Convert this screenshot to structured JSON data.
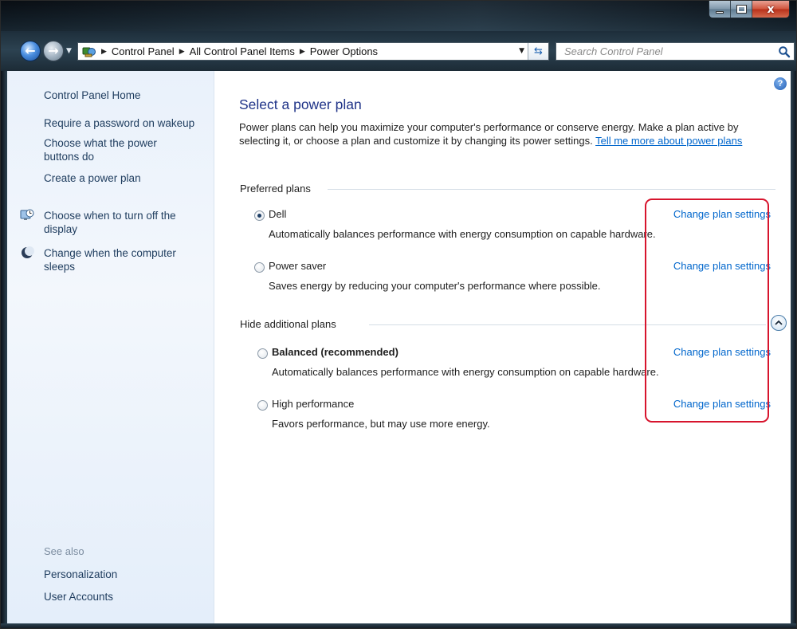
{
  "window": {
    "minimize_icon": "minimize-icon",
    "maximize_icon": "maximize-icon",
    "close_icon": "close-icon",
    "close_glyph": "x"
  },
  "nav": {
    "back_glyph": "←",
    "forward_glyph": "→",
    "breadcrumb": [
      "Control Panel",
      "All Control Panel Items",
      "Power Options"
    ],
    "refresh_glyph": "⇆",
    "search_placeholder": "Search Control Panel"
  },
  "sidebar": {
    "home": "Control Panel Home",
    "links": [
      "Require a password on wakeup",
      "Choose what the power buttons do",
      "Create a power plan",
      "Choose when to turn off the display",
      "Change when the computer sleeps"
    ],
    "see_also_label": "See also",
    "see_also": [
      "Personalization",
      "User Accounts"
    ]
  },
  "main": {
    "help_glyph": "?",
    "title": "Select a power plan",
    "intro": "Power plans can help you maximize your computer's performance or conserve energy. Make a plan active by selecting it, or choose a plan and customize it by changing its power settings.",
    "intro_link": "Tell me more about power plans",
    "preferred_header": "Preferred plans",
    "additional_header": "Hide additional plans",
    "change_link_label": "Change plan settings",
    "preferred_plans": [
      {
        "name": "Dell",
        "selected": true,
        "description": "Automatically balances performance with energy consumption on capable hardware."
      },
      {
        "name": "Power saver",
        "selected": false,
        "description": "Saves energy by reducing your computer's performance where possible."
      }
    ],
    "additional_plans": [
      {
        "name": "Balanced (recommended)",
        "selected": false,
        "bold": true,
        "description": "Automatically balances performance with energy consumption on capable hardware."
      },
      {
        "name": "High performance",
        "selected": false,
        "description": "Favors performance, but may use more energy."
      }
    ]
  },
  "colors": {
    "link": "#0066cc",
    "title": "#1e3287",
    "highlight": "#d7142d",
    "sidebar_bg": "#e9f1fb"
  }
}
